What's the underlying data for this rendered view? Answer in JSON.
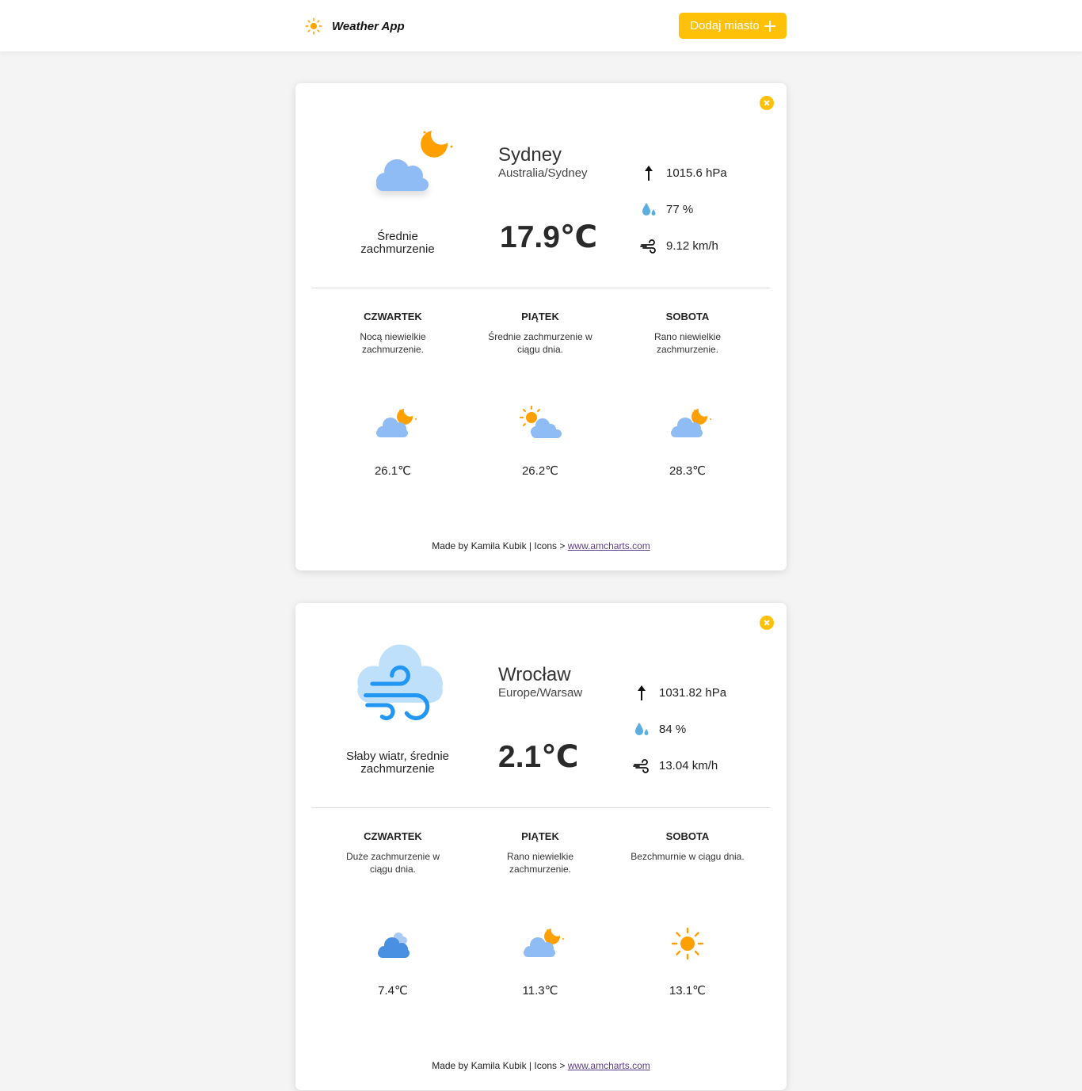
{
  "header": {
    "app_title": "Weather App",
    "add_button_label": "Dodaj miasto",
    "brand_icon": "sun-icon",
    "accent_color": "#ffc107"
  },
  "cards": [
    {
      "city": "Sydney",
      "timezone": "Australia/Sydney",
      "condition": "Średnie zachmurzenie",
      "temperature": "17.9℃",
      "icon": "cloudy-night-icon",
      "pressure": "1015.6 hPa",
      "humidity": "77 %",
      "wind": "9.12 km/h",
      "forecast": [
        {
          "day": "CZWARTEK",
          "desc": "Nocą niewielkie zachmurzenie.",
          "temp": "26.1℃",
          "icon": "cloudy-night-icon"
        },
        {
          "day": "PIĄTEK",
          "desc": "Średnie zachmurzenie w ciągu dnia.",
          "temp": "26.2℃",
          "icon": "cloudy-day-icon"
        },
        {
          "day": "SOBOTA",
          "desc": "Rano niewielkie zachmurzenie.",
          "temp": "28.3℃",
          "icon": "cloudy-night-icon"
        }
      ],
      "footer_text": "Made by Kamila Kubik | Icons > ",
      "footer_link": "www.amcharts.com"
    },
    {
      "city": "Wrocław",
      "timezone": "Europe/Warsaw",
      "condition": "Słaby wiatr, średnie zachmurzenie",
      "temperature": "2.1℃",
      "icon": "wind-cloud-icon",
      "pressure": "1031.82 hPa",
      "humidity": "84 %",
      "wind": "13.04 km/h",
      "forecast": [
        {
          "day": "CZWARTEK",
          "desc": "Duże zachmurzenie w ciągu dnia.",
          "temp": "7.4℃",
          "icon": "cloudy-icon"
        },
        {
          "day": "PIĄTEK",
          "desc": "Rano niewielkie zachmurzenie.",
          "temp": "11.3℃",
          "icon": "cloudy-night-icon"
        },
        {
          "day": "SOBOTA",
          "desc": "Bezchmurnie w ciągu dnia.",
          "temp": "13.1℃",
          "icon": "sun-icon"
        }
      ],
      "footer_text": "Made by Kamila Kubik | Icons > ",
      "footer_link": "www.amcharts.com"
    }
  ]
}
